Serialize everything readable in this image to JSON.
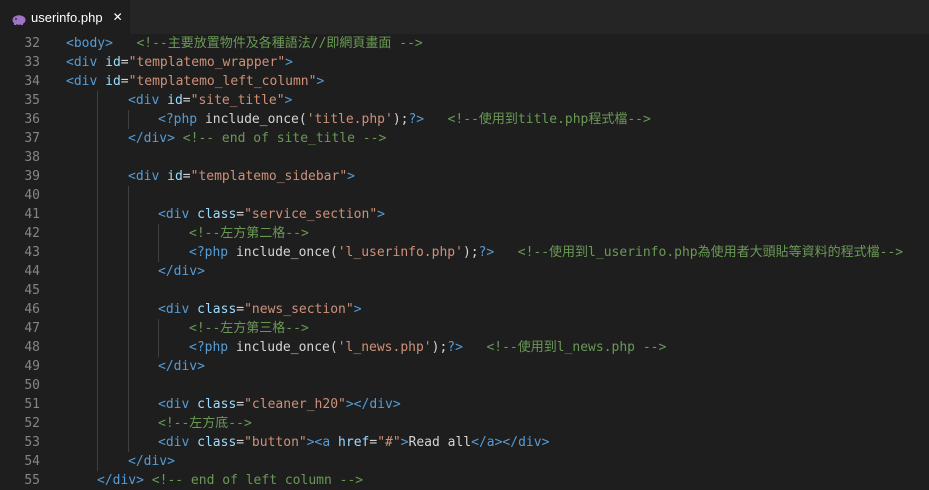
{
  "tab": {
    "label": "userinfo.php",
    "close": "✕",
    "icon": "php-elephant-icon"
  },
  "colors": {
    "background": "#1e1e1e",
    "tag": "#569cd6",
    "attribute": "#9cdcfe",
    "string": "#ce9178",
    "comment": "#6a9955",
    "text": "#d4d4d4",
    "line_number": "#858585"
  },
  "lines": [
    {
      "n": "32",
      "tokens": [
        [
          "tag",
          "<body>"
        ],
        [
          "txt",
          "   "
        ],
        [
          "cmt",
          "<!--主要放置物件及各種語法//即網頁畫面 -->"
        ]
      ]
    },
    {
      "n": "33",
      "tokens": [
        [
          "tag",
          "<div "
        ],
        [
          "attr",
          "id"
        ],
        [
          "txt",
          "="
        ],
        [
          "str",
          "\"templatemo_wrapper\""
        ],
        [
          "tag",
          ">"
        ]
      ]
    },
    {
      "n": "34",
      "tokens": [
        [
          "tag",
          "<div "
        ],
        [
          "attr",
          "id"
        ],
        [
          "txt",
          "="
        ],
        [
          "str",
          "\"templatemo_left_column\""
        ],
        [
          "tag",
          ">"
        ]
      ]
    },
    {
      "n": "35",
      "tokens": [
        [
          "tag",
          "<div "
        ],
        [
          "attr",
          "id"
        ],
        [
          "txt",
          "="
        ],
        [
          "str",
          "\"site_title\""
        ],
        [
          "tag",
          ">"
        ]
      ]
    },
    {
      "n": "36",
      "tokens": [
        [
          "tag",
          "<?php "
        ],
        [
          "txt",
          "include_once("
        ],
        [
          "str",
          "'title.php'"
        ],
        [
          "txt",
          ");"
        ],
        [
          "tag",
          "?>"
        ],
        [
          "txt",
          "   "
        ],
        [
          "cmt",
          "<!--使用到title.php程式檔-->"
        ]
      ]
    },
    {
      "n": "37",
      "tokens": [
        [
          "tag",
          "</div> "
        ],
        [
          "cmt",
          "<!-- end of site_title -->"
        ]
      ]
    },
    {
      "n": "38",
      "tokens": []
    },
    {
      "n": "39",
      "tokens": [
        [
          "tag",
          "<div "
        ],
        [
          "attr",
          "id"
        ],
        [
          "txt",
          "="
        ],
        [
          "str",
          "\"templatemo_sidebar\""
        ],
        [
          "tag",
          ">"
        ]
      ]
    },
    {
      "n": "40",
      "tokens": []
    },
    {
      "n": "41",
      "tokens": [
        [
          "tag",
          "<div "
        ],
        [
          "attr",
          "class"
        ],
        [
          "txt",
          "="
        ],
        [
          "str",
          "\"service_section\""
        ],
        [
          "tag",
          ">"
        ]
      ]
    },
    {
      "n": "42",
      "tokens": [
        [
          "cmt",
          "<!--左方第二格-->"
        ]
      ]
    },
    {
      "n": "43",
      "tokens": [
        [
          "tag",
          "<?php "
        ],
        [
          "txt",
          "include_once("
        ],
        [
          "str",
          "'l_userinfo.php'"
        ],
        [
          "txt",
          ");"
        ],
        [
          "tag",
          "?>"
        ],
        [
          "txt",
          "   "
        ],
        [
          "cmt",
          "<!--使用到l_userinfo.php為使用者大頭貼等資料的程式檔-->"
        ]
      ]
    },
    {
      "n": "44",
      "tokens": [
        [
          "tag",
          "</div>"
        ]
      ]
    },
    {
      "n": "45",
      "tokens": []
    },
    {
      "n": "46",
      "tokens": [
        [
          "tag",
          "<div "
        ],
        [
          "attr",
          "class"
        ],
        [
          "txt",
          "="
        ],
        [
          "str",
          "\"news_section\""
        ],
        [
          "tag",
          ">"
        ]
      ]
    },
    {
      "n": "47",
      "tokens": [
        [
          "cmt",
          "<!--左方第三格-->"
        ]
      ]
    },
    {
      "n": "48",
      "tokens": [
        [
          "tag",
          "<?php "
        ],
        [
          "txt",
          "include_once("
        ],
        [
          "str",
          "'l_news.php'"
        ],
        [
          "txt",
          ");"
        ],
        [
          "tag",
          "?>"
        ],
        [
          "txt",
          "   "
        ],
        [
          "cmt",
          "<!--使用到l_news.php -->"
        ]
      ]
    },
    {
      "n": "49",
      "tokens": [
        [
          "tag",
          "</div>"
        ]
      ]
    },
    {
      "n": "50",
      "tokens": []
    },
    {
      "n": "51",
      "tokens": [
        [
          "tag",
          "<div "
        ],
        [
          "attr",
          "class"
        ],
        [
          "txt",
          "="
        ],
        [
          "str",
          "\"cleaner_h20\""
        ],
        [
          "tag",
          "></div>"
        ]
      ]
    },
    {
      "n": "52",
      "tokens": [
        [
          "cmt",
          "<!--左方底-->"
        ]
      ]
    },
    {
      "n": "53",
      "tokens": [
        [
          "tag",
          "<div "
        ],
        [
          "attr",
          "class"
        ],
        [
          "txt",
          "="
        ],
        [
          "str",
          "\"button\""
        ],
        [
          "tag",
          "><a "
        ],
        [
          "attr",
          "href"
        ],
        [
          "txt",
          "="
        ],
        [
          "str",
          "\"#\""
        ],
        [
          "tag",
          ">"
        ],
        [
          "txt",
          "Read all"
        ],
        [
          "tag",
          "</a></div>"
        ]
      ]
    },
    {
      "n": "54",
      "tokens": [
        [
          "tag",
          "</div>"
        ]
      ]
    },
    {
      "n": "55",
      "tokens": [
        [
          "tag",
          "</div> "
        ],
        [
          "cmt",
          "<!-- end of left column -->"
        ]
      ]
    }
  ]
}
